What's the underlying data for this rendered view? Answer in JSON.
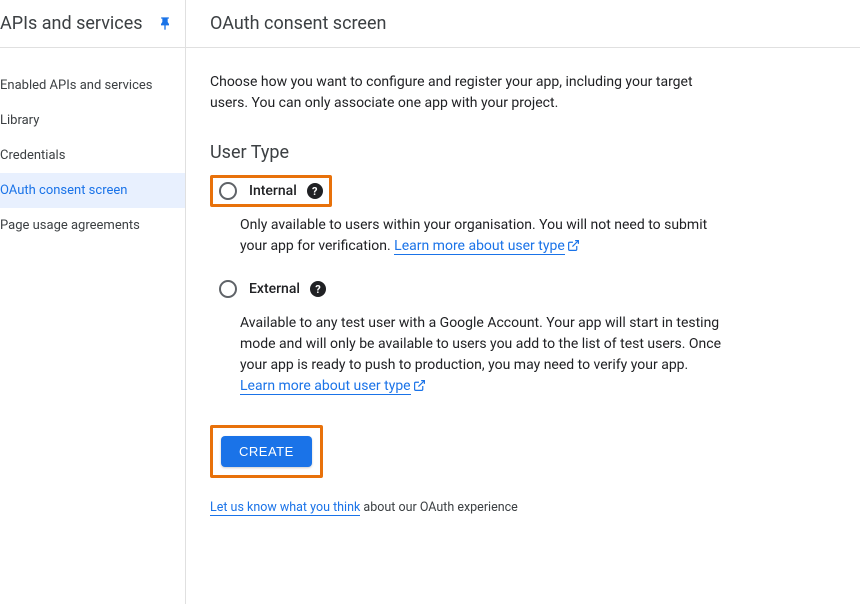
{
  "sidebar": {
    "title": "APIs and services",
    "items": [
      {
        "label": "Enabled APIs and services",
        "active": false
      },
      {
        "label": "Library",
        "active": false
      },
      {
        "label": "Credentials",
        "active": false
      },
      {
        "label": "OAuth consent screen",
        "active": true
      },
      {
        "label": "Page usage agreements",
        "active": false
      }
    ]
  },
  "page": {
    "title": "OAuth consent screen",
    "intro": "Choose how you want to configure and register your app, including your target users. You can only associate one app with your project.",
    "user_type_heading": "User Type",
    "internal": {
      "label": "Internal",
      "desc_prefix": "Only available to users within your organisation. You will not need to submit your app for verification. ",
      "link_text": "Learn more about user type"
    },
    "external": {
      "label": "External",
      "desc_prefix": "Available to any test user with a Google Account. Your app will start in testing mode and will only be available to users you add to the list of test users. Once your app is ready to push to production, you may need to verify your app. ",
      "link_text": "Learn more about user type"
    },
    "create_label": "CREATE",
    "feedback_link": "Let us know what you think",
    "feedback_suffix": " about our OAuth experience"
  }
}
